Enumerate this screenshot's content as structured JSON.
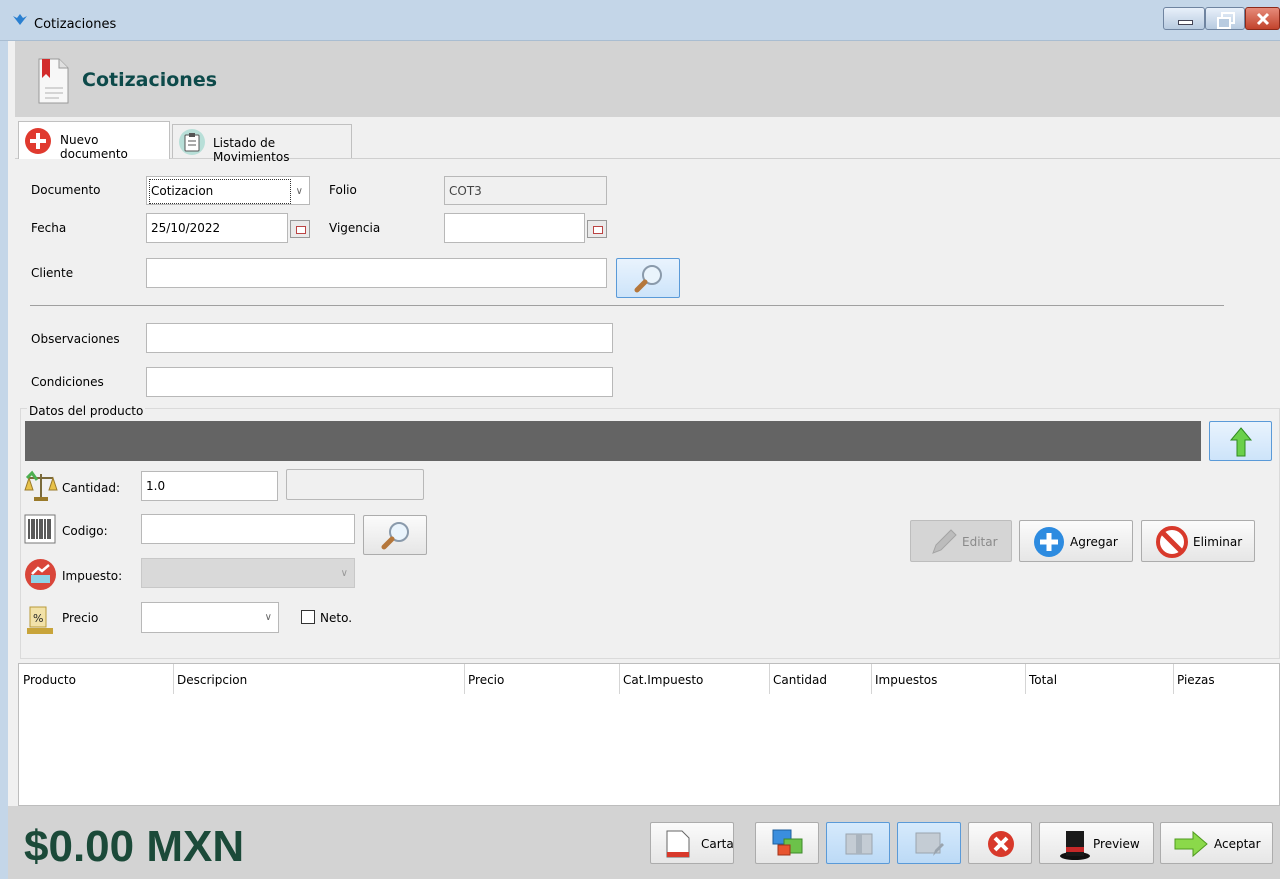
{
  "window": {
    "title": "Cotizaciones"
  },
  "header": {
    "title": "Cotizaciones"
  },
  "tabs": [
    {
      "label": "Nuevo documento"
    },
    {
      "label": "Listado de Movimientos"
    }
  ],
  "form": {
    "documento": {
      "label": "Documento",
      "value": "Cotizacion"
    },
    "folio": {
      "label": "Folio",
      "value": "COT3"
    },
    "fecha": {
      "label": "Fecha",
      "value": "25/10/2022"
    },
    "vigencia": {
      "label": "Vigencia",
      "value": ""
    },
    "cliente": {
      "label": "Cliente",
      "value": ""
    },
    "observaciones": {
      "label": "Observaciones",
      "value": ""
    },
    "condiciones": {
      "label": "Condiciones",
      "value": ""
    }
  },
  "producto": {
    "group_title": "Datos del producto",
    "cantidad": {
      "label": "Cantidad:",
      "value": "1.0"
    },
    "codigo": {
      "label": "Codigo:",
      "value": ""
    },
    "impuesto": {
      "label": "Impuesto:",
      "value": ""
    },
    "precio": {
      "label": "Precio",
      "value": ""
    },
    "neto": {
      "label": "Neto.",
      "checked": false
    },
    "buttons": {
      "editar": "Editar",
      "agregar": "Agregar",
      "eliminar": "Eliminar"
    }
  },
  "table": {
    "columns": [
      "Producto",
      "Descripcion",
      "Precio",
      "Cat.Impuesto",
      "Cantidad",
      "Impuestos",
      "Total",
      "Piezas"
    ],
    "rows": []
  },
  "footer": {
    "total": "$0.00 MXN",
    "buttons": {
      "carta": "Carta",
      "preview": "Preview",
      "aceptar": "Aceptar"
    }
  },
  "colors": {
    "total_text": "#1b4a39",
    "header_title": "#0d4a4a",
    "dark_bar": "#646464"
  }
}
